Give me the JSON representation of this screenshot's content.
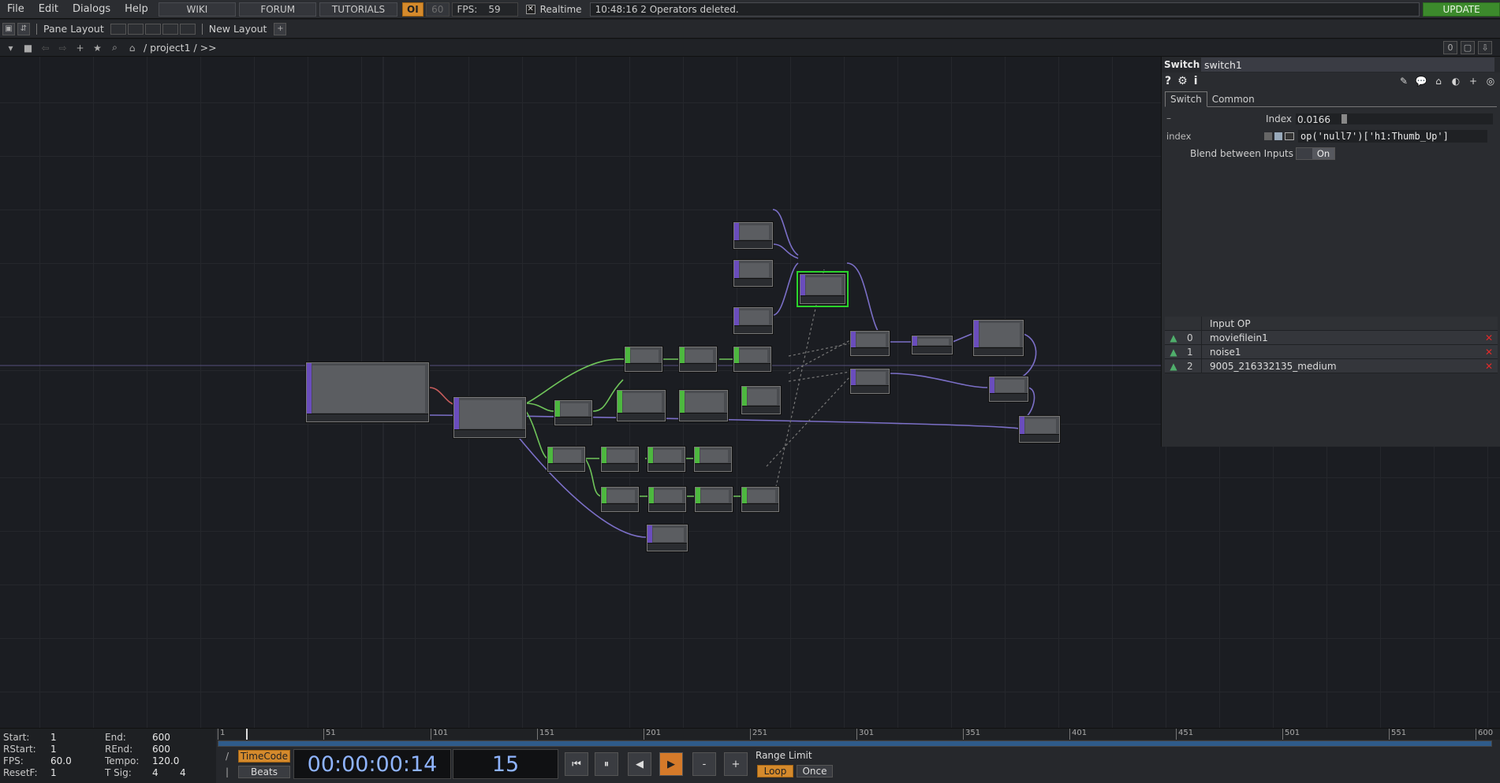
{
  "menu": {
    "items": [
      "File",
      "Edit",
      "Dialogs",
      "Help"
    ],
    "wiki": "WIKI",
    "forum": "FORUM",
    "tutorials": "TUTORIALS",
    "oi": "OI",
    "sixty": "60",
    "fps_label": "FPS:",
    "fps_value": "59",
    "realtime_label": "Realtime",
    "status": "10:48:16 2 Operators deleted.",
    "update": "UPDATE"
  },
  "panebar": {
    "pane_layout": "Pane Layout",
    "new_layout": "New Layout"
  },
  "pathbar": {
    "path": "/ project1 / >>",
    "counter": "0"
  },
  "params": {
    "op_type": "Switch",
    "op_name": "switch1",
    "tabs": [
      "Switch",
      "Common"
    ],
    "index_label": "Index",
    "index_value": "0.0166",
    "index_level": 0.0166,
    "expr_label": "index",
    "expr": "op('null7')['h1:Thumb_Up']",
    "blend_label": "Blend between Inputs",
    "blend_value": "On",
    "table_header": "Input OP",
    "inputs": [
      {
        "idx": "0",
        "name": "moviefilein1"
      },
      {
        "idx": "1",
        "name": "noise1"
      },
      {
        "idx": "2",
        "name": "9005_216332135_medium"
      }
    ]
  },
  "timeline": {
    "start_label": "Start:",
    "start": "1",
    "rstart_label": "RStart:",
    "rstart": "1",
    "fps_label": "FPS:",
    "fps": "60.0",
    "resetf_label": "ResetF:",
    "resetf": "1",
    "end_label": "End:",
    "end": "600",
    "rend_label": "REnd:",
    "rend": "600",
    "tempo_label": "Tempo:",
    "tempo": "120.0",
    "tsig_label": "T Sig:",
    "tsig_a": "4",
    "tsig_b": "4",
    "ticks": [
      "1",
      "51",
      "101",
      "151",
      "201",
      "251",
      "301",
      "351",
      "401",
      "451",
      "501",
      "551",
      "600"
    ],
    "timecode_btn": "TimeCode",
    "beats_btn": "Beats",
    "timecode": "00:00:00:14",
    "frame": "15",
    "range_limit": "Range Limit",
    "loop": "Loop",
    "once": "Once",
    "minus": "-",
    "plus": "+"
  },
  "colors": {
    "accent": "#d58a2c",
    "update": "#3c8a2c",
    "selected": "#2ad42a",
    "top_stripe": "#6a4dbd",
    "chop_stripe": "#4db83f"
  }
}
